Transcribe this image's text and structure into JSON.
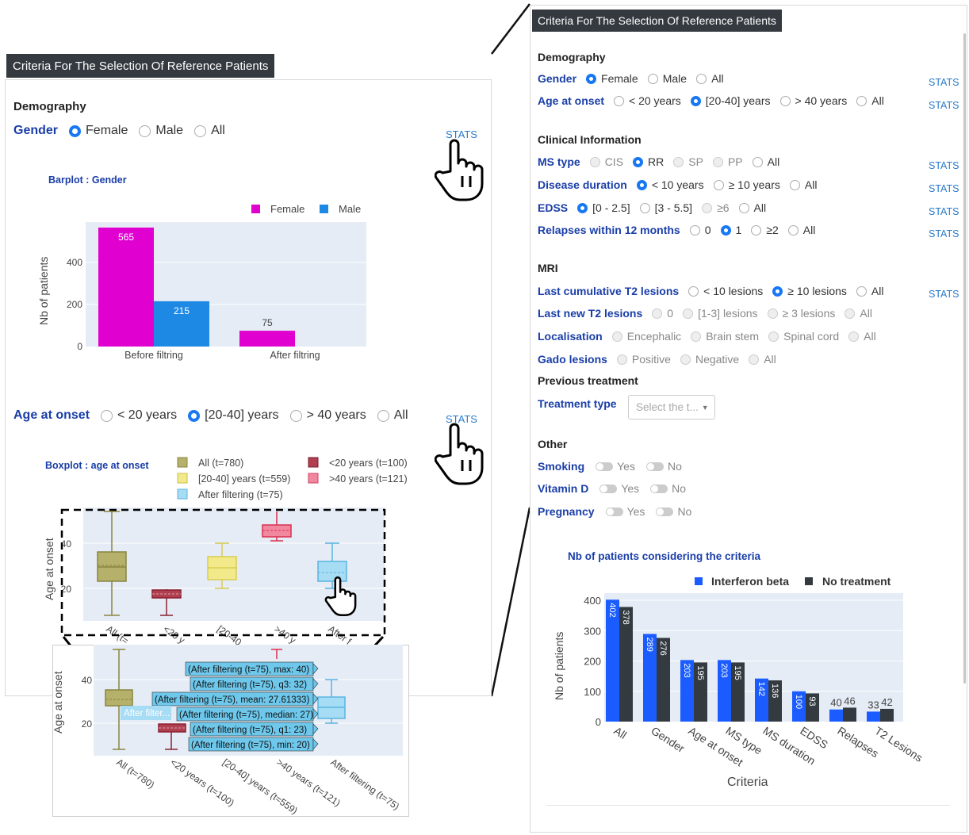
{
  "left_panel": {
    "title": "Criteria For The Selection Of Reference Patients",
    "demography": "Demography",
    "gender": {
      "label": "Gender",
      "options": [
        "Female",
        "Male",
        "All"
      ],
      "selected": "Female"
    },
    "stats": "STATS",
    "barplot": {
      "title": "Barplot : Gender",
      "legend": [
        "Female",
        "Male"
      ],
      "ylabel": "Nb of patients"
    },
    "age_at_onset": {
      "label": "Age at onset",
      "options": [
        "< 20 years",
        "[20-40] years",
        "> 40 years",
        "All"
      ],
      "selected": "[20-40] years"
    },
    "boxplot": {
      "title": "Boxplot : age at onset",
      "legend": [
        "All (t=780)",
        "<20 years (t=100)",
        "[20-40] years (t=559)",
        ">40 years (t=121)",
        "After filtering (t=75)"
      ],
      "ylabel": "Age at onset",
      "short_ticks": [
        "All (t=",
        "<20 y",
        "[20-40",
        ">40 y",
        "After f"
      ]
    }
  },
  "zoom": {
    "ylabel": "Age at onset",
    "ticks": [
      "All (t=780)",
      "<20 years (t=100)",
      "[20-40] years (t=559)",
      ">40 years (t=121)",
      "After filtering (t=75)"
    ],
    "tooltips": [
      "(After filtering (t=75), max: 40)",
      "(After filtering (t=75), q3: 32)",
      "(After filtering (t=75), mean: 27.61333)",
      "(After filtering (t=75), median: 27)",
      "(After filtering (t=75), q1: 23)",
      "(After filtering (t=75), min: 20)"
    ],
    "name_tag": "After filter..."
  },
  "right_panel": {
    "title": "Criteria For The Selection Of Reference Patients",
    "stats": "STATS",
    "sections": {
      "demography": "Demography",
      "clinical": "Clinical Information",
      "mri": "MRI",
      "previous": "Previous treatment",
      "other": "Other"
    },
    "gender": {
      "label": "Gender",
      "options": [
        "Female",
        "Male",
        "All"
      ]
    },
    "age": {
      "label": "Age at onset",
      "options": [
        "< 20 years",
        "[20-40] years",
        "> 40 years",
        "All"
      ]
    },
    "ms_type": {
      "label": "MS type",
      "options": [
        "CIS",
        "RR",
        "SP",
        "PP",
        "All"
      ]
    },
    "disease_duration": {
      "label": "Disease duration",
      "options": [
        "< 10 years",
        "≥ 10 years",
        "All"
      ]
    },
    "edss": {
      "label": "EDSS",
      "options": [
        "[0 - 2.5]",
        "[3 - 5.5]",
        "≥6",
        "All"
      ]
    },
    "relapses": {
      "label": "Relapses within 12 months",
      "options": [
        "0",
        "1",
        "≥2",
        "All"
      ]
    },
    "last_t2": {
      "label": "Last cumulative T2 lesions",
      "options": [
        "< 10 lesions",
        "≥ 10 lesions",
        "All"
      ]
    },
    "last_new_t2": {
      "label": "Last new T2 lesions",
      "options": [
        "0",
        "[1-3] lesions",
        "≥ 3 lesions",
        "All"
      ]
    },
    "localisation": {
      "label": "Localisation",
      "options": [
        "Encephalic",
        "Brain stem",
        "Spinal cord",
        "All"
      ]
    },
    "gado": {
      "label": "Gado lesions",
      "options": [
        "Positive",
        "Negative",
        "All"
      ]
    },
    "treatment": {
      "label": "Treatment type",
      "placeholder": "Select the t..."
    },
    "smoking": {
      "label": "Smoking",
      "yes": "Yes",
      "no": "No"
    },
    "vitamin_d": {
      "label": "Vitamin D",
      "yes": "Yes",
      "no": "No"
    },
    "pregnancy": {
      "label": "Pregnancy",
      "yes": "Yes",
      "no": "No"
    }
  },
  "colors": {
    "female": "#e000d0",
    "male": "#1e88e5",
    "interferon": "#1a5cff",
    "no_treatment": "#333a40",
    "all_box": "#b5b06a",
    "lt20_box": "#b04050",
    "mid_box": "#f2ea8a",
    "gt40_box": "#e66a7c",
    "after_box": "#a6dcf4"
  },
  "chart_data": [
    {
      "type": "bar",
      "title": "Barplot : Gender",
      "categories": [
        "Before filtring",
        "After filtring"
      ],
      "series": [
        {
          "name": "Female",
          "values": [
            565,
            75
          ]
        },
        {
          "name": "Male",
          "values": [
            215,
            null
          ]
        }
      ],
      "ylabel": "Nb of patients",
      "ylim": [
        0,
        565
      ]
    },
    {
      "type": "bar",
      "title": "Nb of patients considering the criteria",
      "categories": [
        "All",
        "Gender",
        "Age at onset",
        "MS type",
        "MS duration",
        "EDSS",
        "Relapses",
        "T2 Lesions"
      ],
      "series": [
        {
          "name": "Interferon beta",
          "values": [
            402,
            289,
            203,
            203,
            142,
            100,
            40,
            33
          ]
        },
        {
          "name": "No treatment",
          "values": [
            378,
            276,
            195,
            195,
            136,
            93,
            46,
            42
          ]
        }
      ],
      "xlabel": "Criteria",
      "ylabel": "Nb of patients",
      "yticks": [
        0,
        100,
        200,
        300,
        400
      ],
      "ylim": [
        0,
        400
      ],
      "legend": "top"
    },
    {
      "type": "box",
      "title": "Boxplot : age at onset",
      "ylabel": "Age at onset",
      "yticks": [
        20,
        40
      ],
      "series": [
        {
          "name": "After filtering (t=75)",
          "min": 20,
          "q1": 23,
          "median": 27,
          "mean": 27.61333,
          "q3": 32,
          "max": 40
        }
      ]
    }
  ]
}
